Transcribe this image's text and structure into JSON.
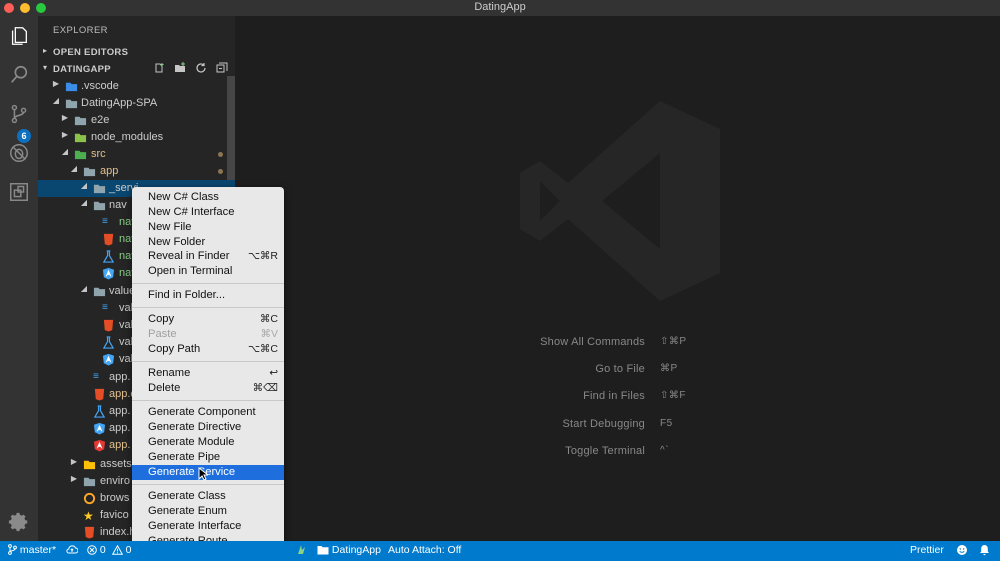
{
  "window": {
    "title": "DatingApp"
  },
  "activity_bar": {
    "items": [
      "explorer-icon",
      "search-icon",
      "source-control-icon",
      "debug-icon",
      "extensions-icon"
    ],
    "scm_badge": "6",
    "manage": "gear-icon"
  },
  "sidebar": {
    "title": "EXPLORER",
    "open_editors": "OPEN EDITORS",
    "workspace": "DATINGAPP",
    "tree": {
      "vscode": ".vscode",
      "spa": "DatingApp-SPA",
      "e2e": "e2e",
      "node_modules": "node_modules",
      "src": "src",
      "app": "app",
      "services": "_servi",
      "nav": "nav",
      "nav_css": "nav",
      "nav_html": "nav",
      "nav_spec": "nav",
      "nav_ts": "nav",
      "value": "value",
      "value_css": "val",
      "value_html": "val",
      "value_spec": "val",
      "value_ts": "val",
      "app_css": "app.",
      "app_html": "app.c",
      "app_spec": "app.",
      "app_ts": "app.",
      "app_module": "app.",
      "assets": "assets",
      "environments": "enviro",
      "browserslist": "brows",
      "favicon": "favico",
      "index": "index.h"
    }
  },
  "context_menu": {
    "new_cs_class": "New C# Class",
    "new_cs_interface": "New C# Interface",
    "new_file": "New File",
    "new_folder": "New Folder",
    "reveal_in_finder": "Reveal in Finder",
    "reveal_in_finder_key": "⌥⌘R",
    "open_in_terminal": "Open in Terminal",
    "find_in_folder": "Find in Folder...",
    "copy": "Copy",
    "copy_key": "⌘C",
    "paste": "Paste",
    "paste_key": "⌘V",
    "copy_path": "Copy Path",
    "copy_path_key": "⌥⌘C",
    "rename": "Rename",
    "rename_key": "↩",
    "delete": "Delete",
    "delete_key": "⌘⌫",
    "gen_component": "Generate Component",
    "gen_directive": "Generate Directive",
    "gen_module": "Generate Module",
    "gen_pipe": "Generate Pipe",
    "gen_service": "Generate Service",
    "gen_class": "Generate Class",
    "gen_enum": "Generate Enum",
    "gen_interface": "Generate Interface",
    "gen_route": "Generate Route"
  },
  "editor_hints": [
    {
      "label": "Show All Commands",
      "keys": "⇧⌘P"
    },
    {
      "label": "Go to File",
      "keys": "⌘P"
    },
    {
      "label": "Find in Files",
      "keys": "⇧⌘F"
    },
    {
      "label": "Start Debugging",
      "keys": "F5"
    },
    {
      "label": "Toggle Terminal",
      "keys": "^`"
    }
  ],
  "status_bar": {
    "branch": "master*",
    "errors": "0",
    "warnings": "0",
    "folder": "DatingApp",
    "auto_attach": "Auto Attach: Off",
    "prettier": "Prettier"
  }
}
